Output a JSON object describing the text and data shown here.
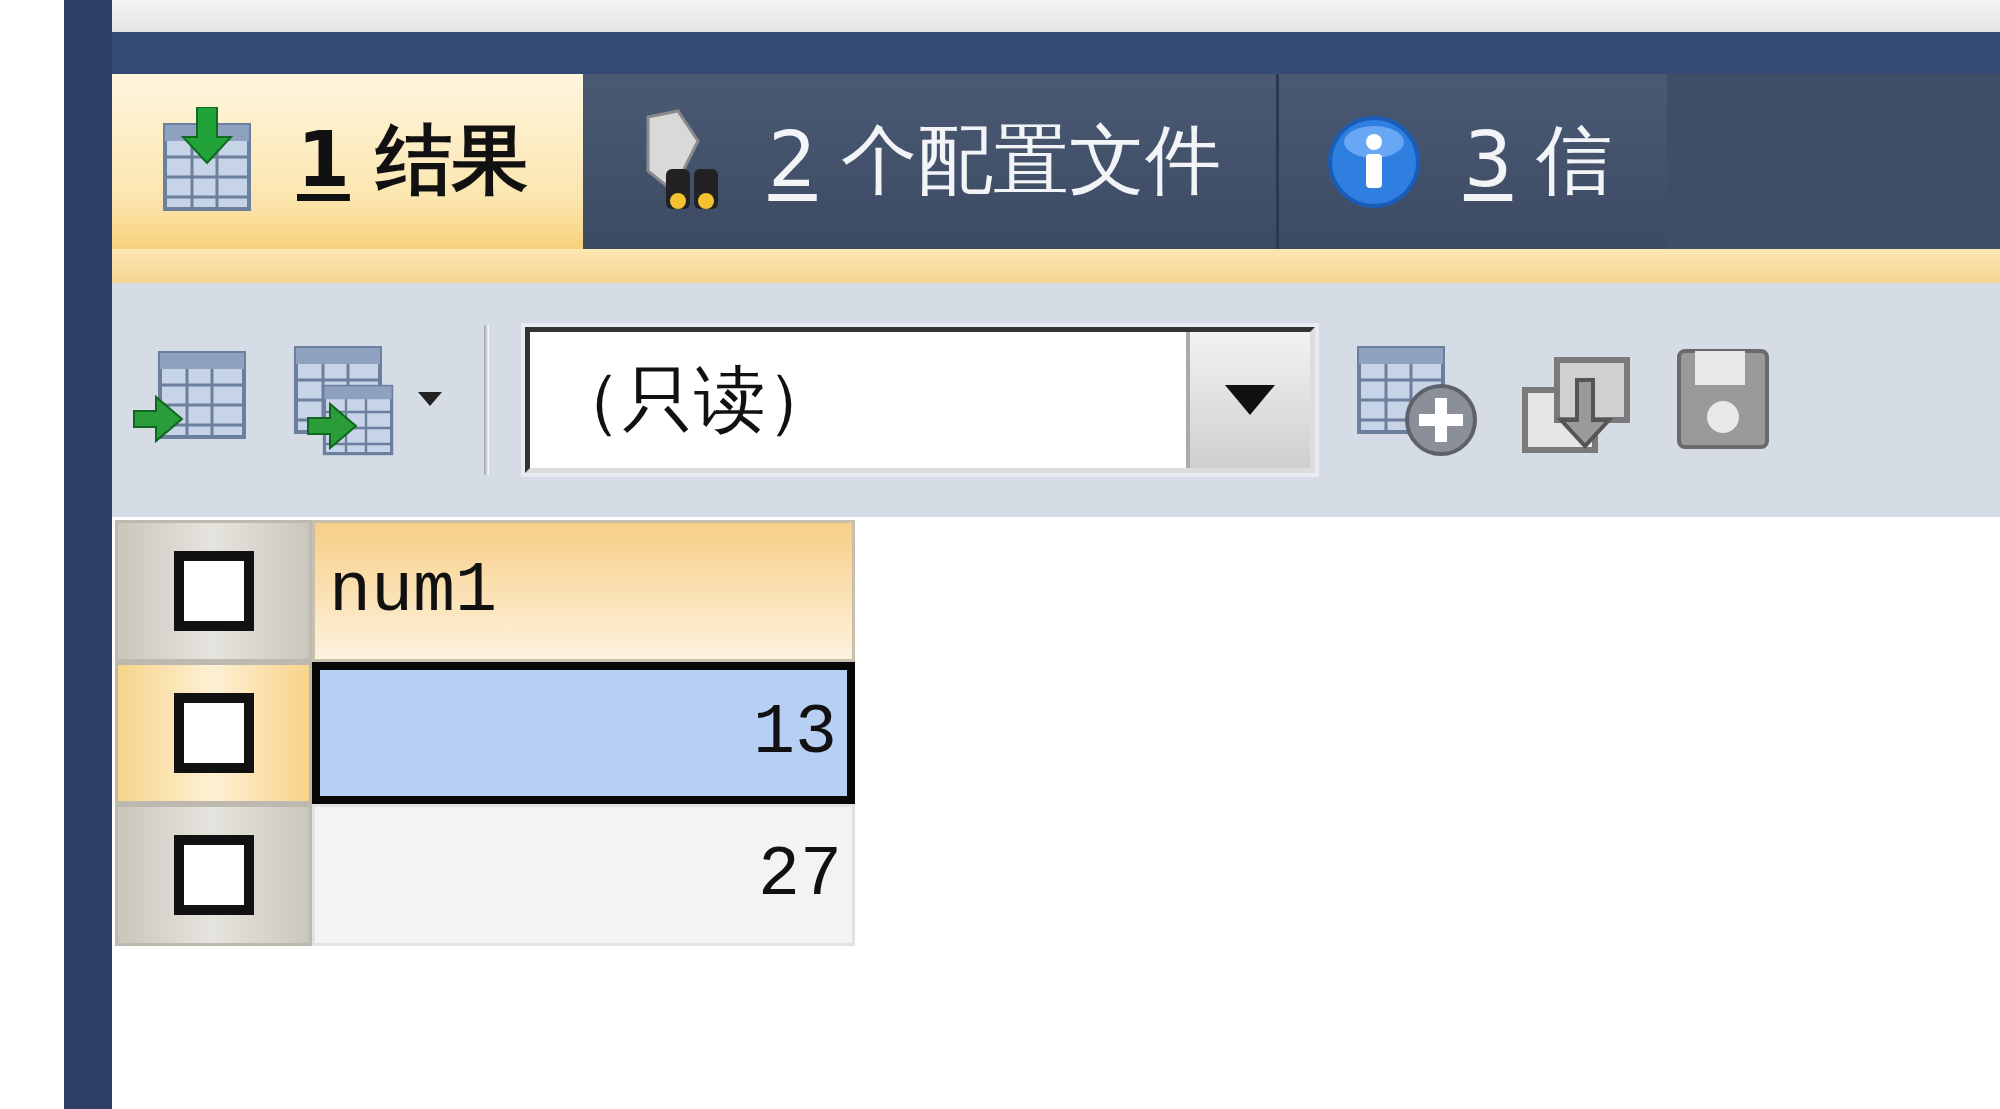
{
  "tabs": [
    {
      "number": "1",
      "label": "结果",
      "selected": true
    },
    {
      "number": "2",
      "label": "个配置文件",
      "selected": false
    },
    {
      "number": "3",
      "label": "信",
      "selected": false
    }
  ],
  "toolbar": {
    "mode_select": {
      "value": "（只读）"
    }
  },
  "grid": {
    "header_checkbox": {
      "checked": false
    },
    "columns": [
      "num1"
    ],
    "rows": [
      {
        "selected": true,
        "checked": false,
        "cells": [
          "13"
        ]
      },
      {
        "selected": false,
        "checked": false,
        "cells": [
          "27"
        ]
      }
    ]
  }
}
